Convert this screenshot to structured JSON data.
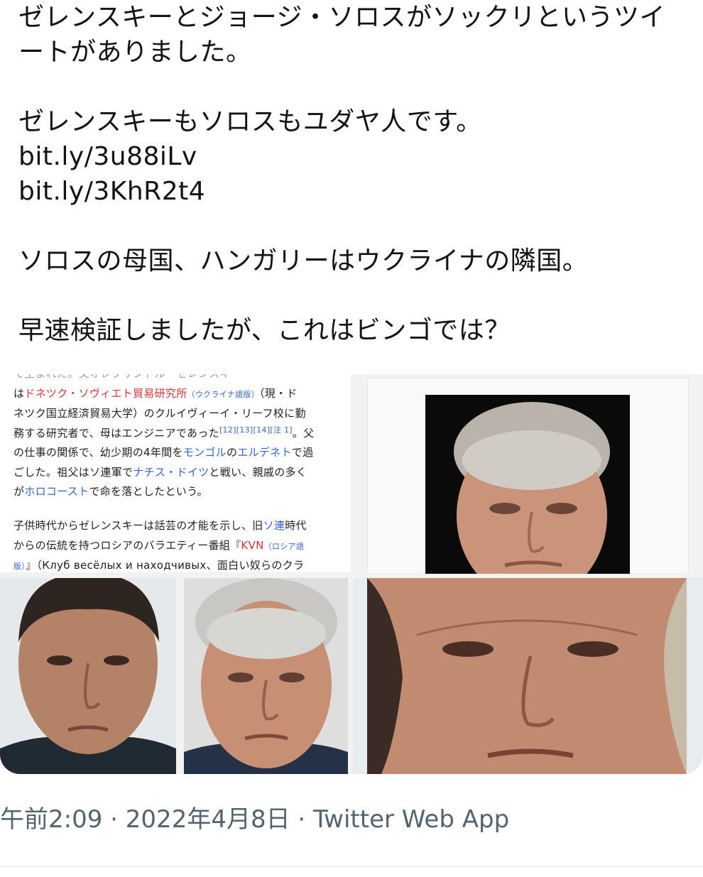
{
  "tweet": {
    "lines": [
      "ゼレンスキーとジョージ・ソロスがソックリというツイ",
      "ートがありました。",
      "",
      "ゼレンスキーもソロスもユダヤ人です。",
      "bit.ly/3u88iLv",
      "bit.ly/3KhR2t4",
      "",
      "ソロスの母国、ハンガリーはウクライナの隣国。",
      "",
      "早速検証しましたが、これはビンゴでは？"
    ]
  },
  "wiki_excerpt": {
    "p1": {
      "l0": "で生まれた。父オレクサンドル・ゼレンスキ",
      "l1_a": "は",
      "l1_link": "ドネツク・ソヴィエト貿易研究所",
      "l1_small": "（ウクライナ語版）",
      "l1_b": "（現・ド",
      "l2": "ネツク国立経済貿易大学）のクルイヴィーイ・リーフ校に勤",
      "l3_a": "務する研究者で、母はエンジニアであった",
      "l3_sup": "[12][13][14][注 1]",
      "l3_b": "。父",
      "l4_a": "の仕事の関係で、幼少期の4年間を",
      "l4_link1": "モンゴル",
      "l4_mid": "の",
      "l4_link2": "エルデネト",
      "l4_b": "で過",
      "l5_a": "ごした。祖父はソ連軍で",
      "l5_link": "ナチス・ドイツ",
      "l5_b": "と戦い、親戚の多く",
      "l6_a": "が",
      "l6_link": "ホロコースト",
      "l6_b": "で命を落としたという。"
    },
    "p2": {
      "l0_a": "子供時代からゼレンスキーは話芸の才能を示し、旧",
      "l0_link": "ソ連",
      "l0_b": "時代",
      "l1_a": "からの伝統を持つロシアのバラエティー番組『",
      "l1_link": "KVN",
      "l1_small": "（ロシア語",
      "l2_small": "版）",
      "l2_b": "』（Клуб весёлых и находчивых、面白い奴らのクラ"
    }
  },
  "meta": {
    "time": "午前2:09",
    "sep1": " · ",
    "date": "2022年4月8日",
    "sep2": " · ",
    "source": "Twitter Web App"
  },
  "colors": {
    "text": "#0f1419",
    "secondary": "#536471",
    "wiki_link": "#3366cc",
    "wiki_redlink": "#d33"
  }
}
